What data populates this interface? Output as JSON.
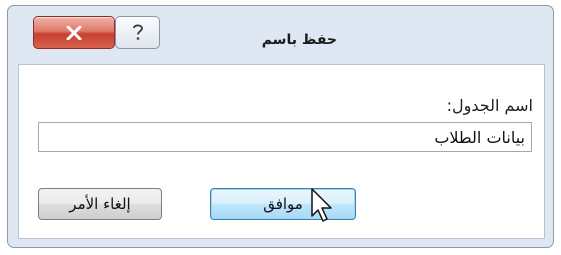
{
  "dialog": {
    "title": "حفظ باسم",
    "close_icon": "close-x-icon",
    "help_icon": "question-mark-icon"
  },
  "form": {
    "table_name_label": "اسم الجدول:",
    "table_name_value": "بيانات الطلاب"
  },
  "buttons": {
    "ok_label": "موافق",
    "cancel_label": "إلغاء الأمر"
  },
  "colors": {
    "close_button": "#c7412f",
    "ok_button_border": "#3c7fb1",
    "dialog_frame": "#dfe7f2"
  },
  "cursor": "arrow-pointer-icon"
}
